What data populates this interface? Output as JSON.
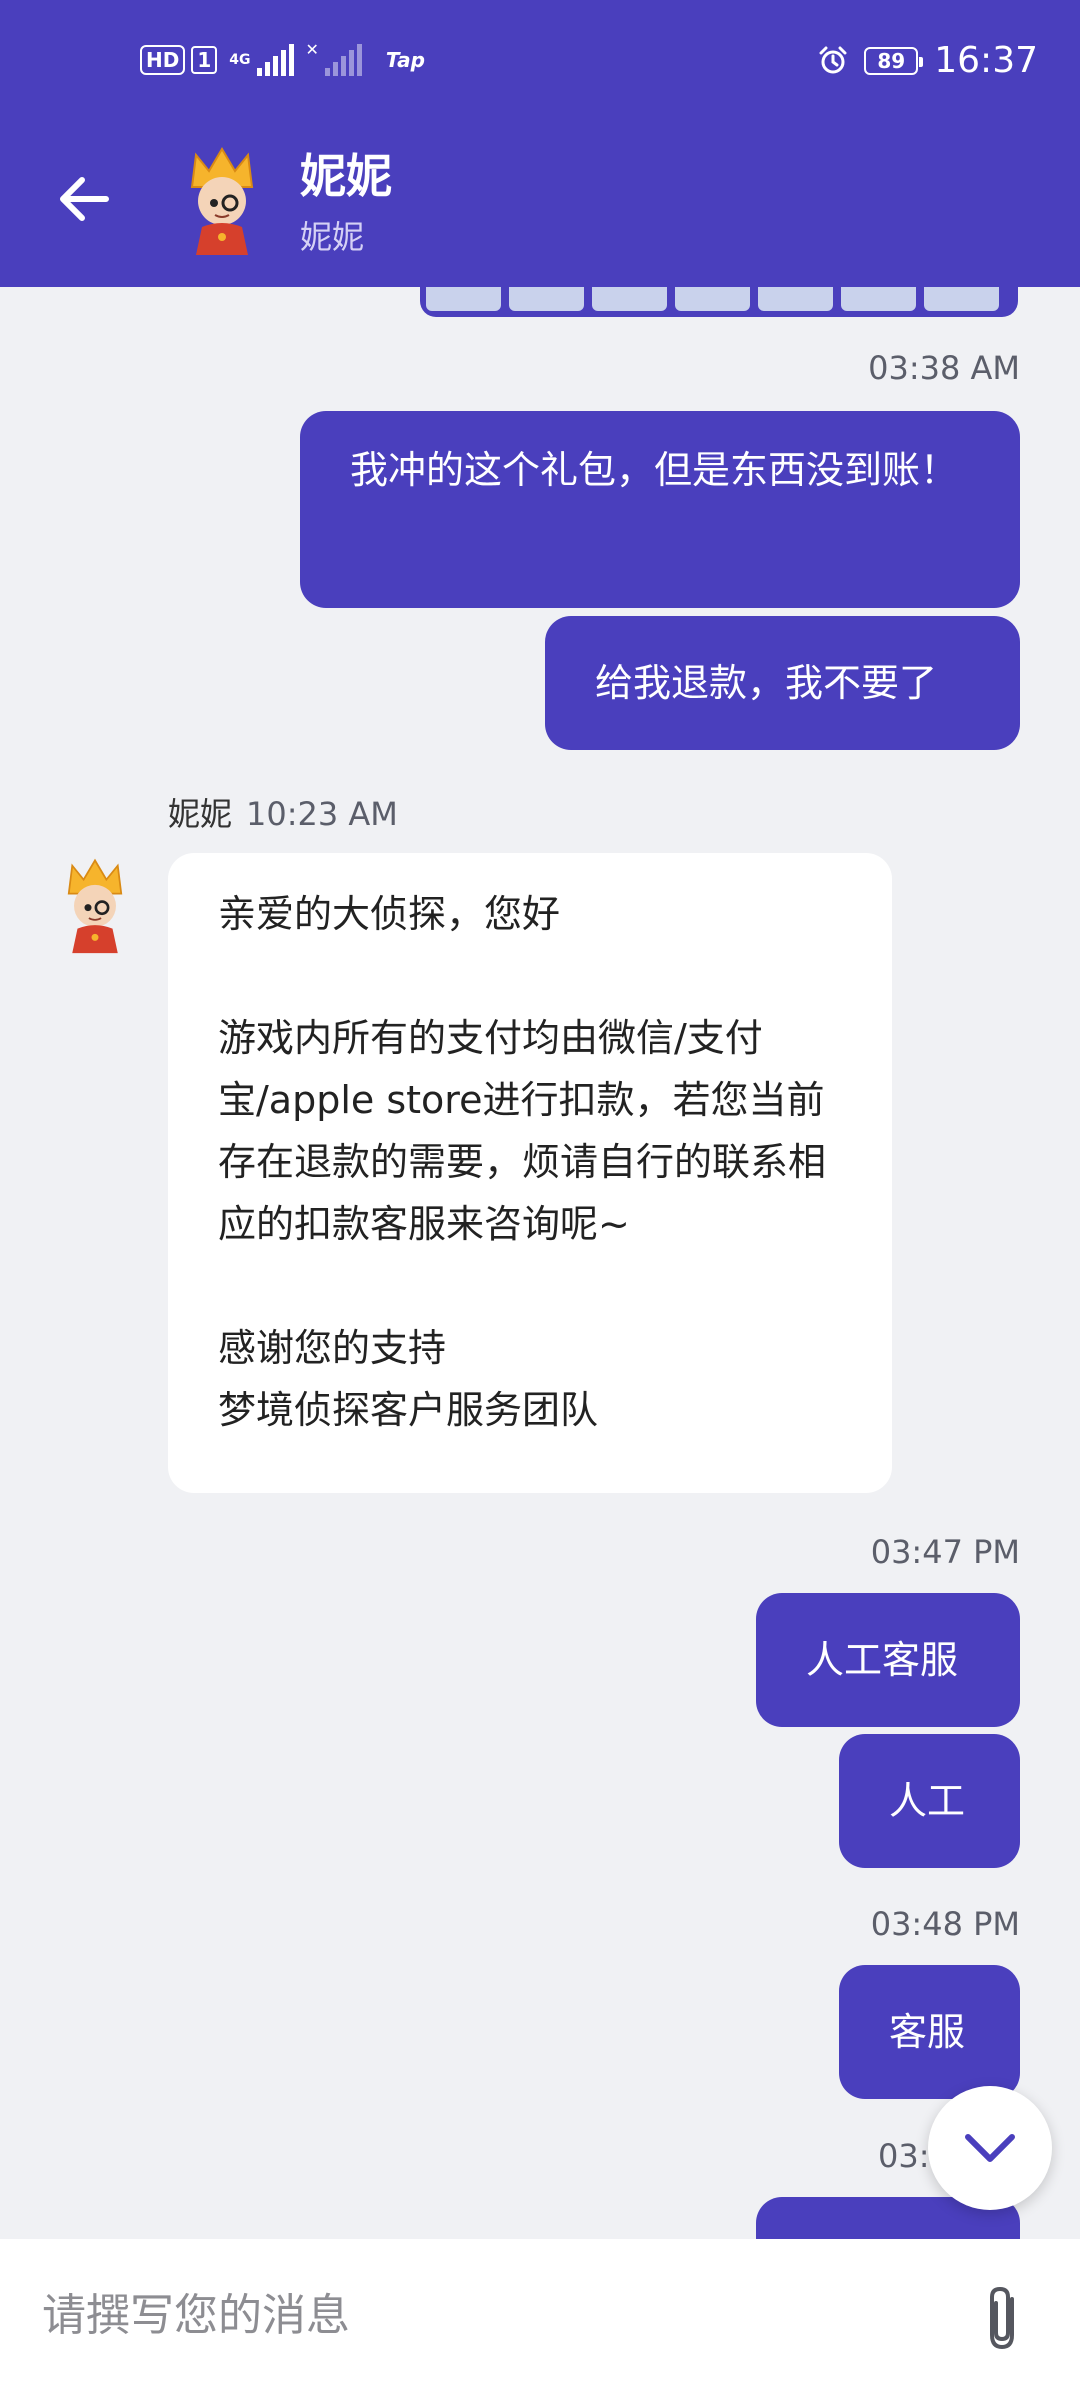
{
  "status_bar": {
    "hd": "HD",
    "sim": "1",
    "network": "4G",
    "app_badge": "Tap",
    "battery": "89",
    "time": "16:37"
  },
  "header": {
    "title": "妮妮",
    "subtitle": "妮妮"
  },
  "messages": {
    "ts1": "03:38 AM",
    "out1": "我冲的这个礼包，但是东西没到账！",
    "out2": "给我退款，我不要了",
    "agent_name": "妮妮",
    "agent_time": "10:23 AM",
    "in_line1": "亲爱的大侦探，您好",
    "in_para2": "游戏内所有的支付均由微信/支付宝/apple store进行扣款，若您当前存在退款的需要，烦请自行的联系相应的扣款客服来咨询呢~",
    "in_line3": "感谢您的支持",
    "in_line4": "梦境侦探客户服务团队",
    "ts2": "03:47 PM",
    "out3": "人工客服",
    "out4": "人工",
    "ts3": "03:48 PM",
    "out5": "客服",
    "ts4_partial": "03:"
  },
  "input": {
    "placeholder": "请撰写您的消息"
  },
  "icons": {
    "back": "arrow-left-icon",
    "attach": "paperclip-icon",
    "scroll": "chevron-down-icon",
    "alarm": "alarm-icon"
  },
  "colors": {
    "primary": "#4a3fbd",
    "background": "#f0f1f4",
    "incoming_bubble": "#ffffff"
  }
}
